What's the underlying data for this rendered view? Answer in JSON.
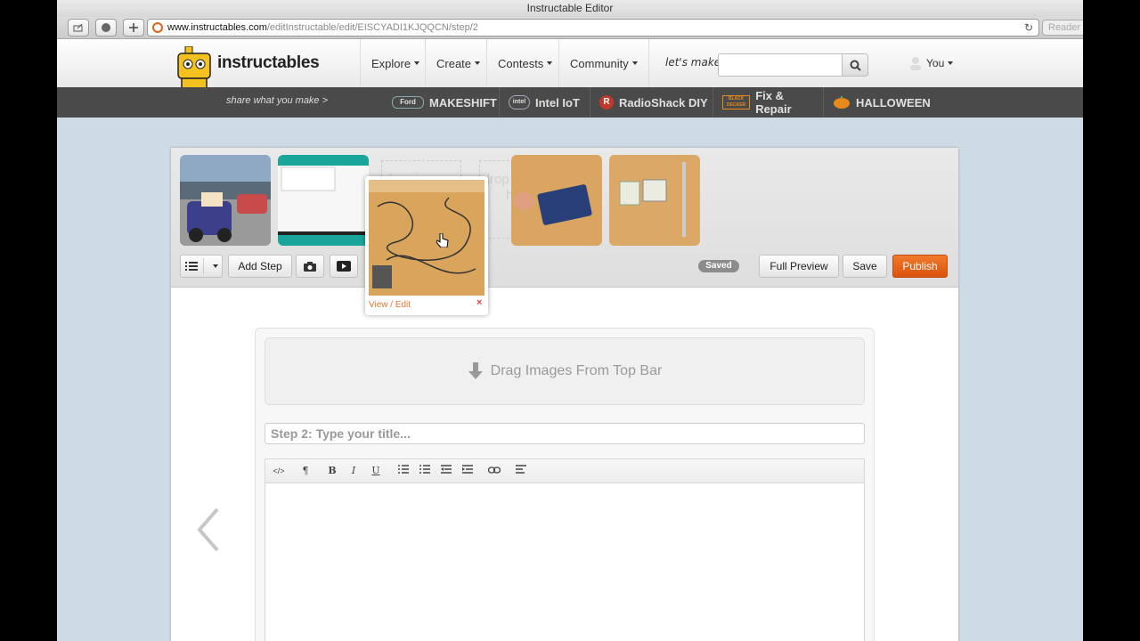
{
  "browser": {
    "window_title": "Instructable Editor",
    "url_domain": "www.instructables.com",
    "url_path": "/editInstructable/edit/EISCYADI1KJQQCN/step/2",
    "reader_label": "Reader"
  },
  "site": {
    "logo_text": "instructables",
    "nav": [
      {
        "label": "Explore"
      },
      {
        "label": "Create"
      },
      {
        "label": "Contests"
      },
      {
        "label": "Community"
      }
    ],
    "lets_make_label": "let's make",
    "search_placeholder": "",
    "user_label": "You",
    "tagline": "share what you make >",
    "channels": [
      {
        "label": "MAKESHIFT"
      },
      {
        "label": "Intel IoT"
      },
      {
        "label": "RadioShack DIY"
      },
      {
        "label": "Fix & Repair"
      },
      {
        "label": "HALLOWEEN"
      }
    ],
    "colors": {
      "accent": "#e06415",
      "darkbar": "#4a4a4a",
      "page_bg": "#cfdbe4"
    }
  },
  "editor": {
    "drop_slot_text": "drop images here",
    "buttons": {
      "add_step": "Add Step",
      "saved_badge": "Saved",
      "full_preview": "Full Preview",
      "save": "Save",
      "publish": "Publish"
    },
    "drag_card": {
      "view_edit": "View / Edit",
      "close": "×"
    },
    "step": {
      "drop_zone_text": "Drag Images From Top Bar",
      "title_placeholder": "Step 2:  Type your title..."
    },
    "rte_buttons": [
      "</>",
      "¶",
      "B",
      "I",
      "U"
    ]
  }
}
